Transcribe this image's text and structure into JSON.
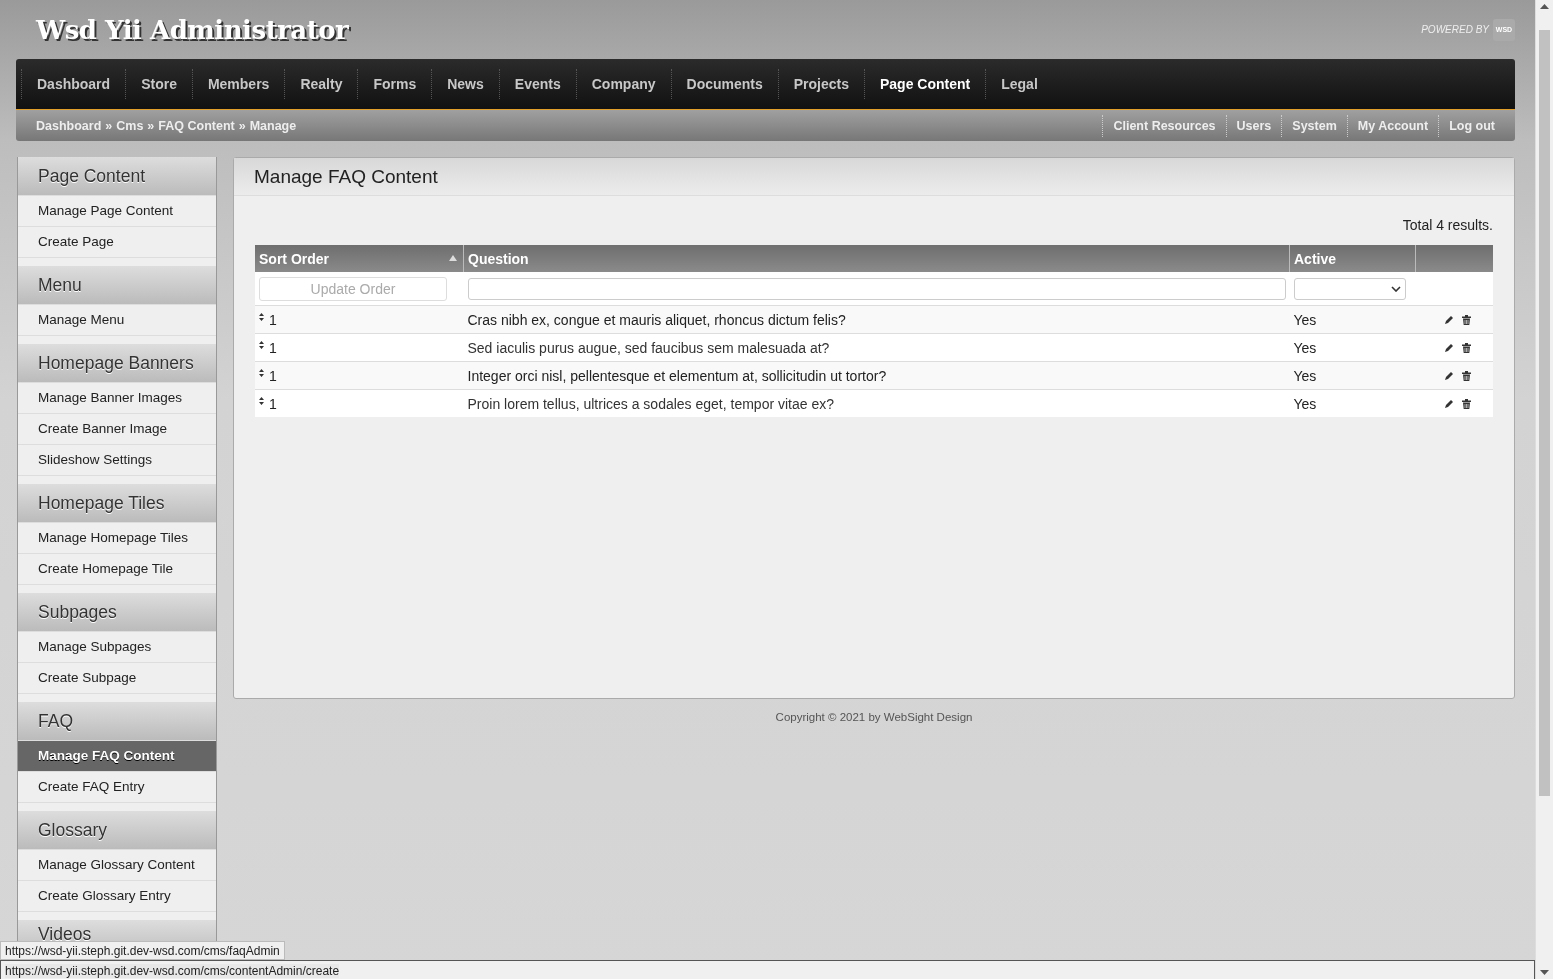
{
  "header": {
    "title": "Wsd Yii Administrator",
    "powered_by": "POWERED BY",
    "logo": "WSD"
  },
  "nav": [
    {
      "label": "Dashboard",
      "selected": false
    },
    {
      "label": "Store",
      "selected": false
    },
    {
      "label": "Members",
      "selected": false
    },
    {
      "label": "Realty",
      "selected": false
    },
    {
      "label": "Forms",
      "selected": false
    },
    {
      "label": "News",
      "selected": false
    },
    {
      "label": "Events",
      "selected": false
    },
    {
      "label": "Company",
      "selected": false
    },
    {
      "label": "Documents",
      "selected": false
    },
    {
      "label": "Projects",
      "selected": false
    },
    {
      "label": "Page Content",
      "selected": true
    },
    {
      "label": "Legal",
      "selected": false
    }
  ],
  "breadcrumb": {
    "separator": "»",
    "items": [
      "Dashboard",
      "Cms",
      "FAQ Content",
      "Manage"
    ]
  },
  "user_menu": [
    "Client Resources",
    "Users",
    "System",
    "My Account",
    "Log out"
  ],
  "sidebar": [
    {
      "title": "Page Content",
      "items": [
        {
          "label": "Manage Page Content",
          "selected": false
        },
        {
          "label": "Create Page",
          "selected": false
        }
      ]
    },
    {
      "title": "Menu",
      "items": [
        {
          "label": "Manage Menu",
          "selected": false
        }
      ]
    },
    {
      "title": "Homepage Banners",
      "items": [
        {
          "label": "Manage Banner Images",
          "selected": false
        },
        {
          "label": "Create Banner Image",
          "selected": false
        },
        {
          "label": "Slideshow Settings",
          "selected": false
        }
      ]
    },
    {
      "title": "Homepage Tiles",
      "items": [
        {
          "label": "Manage Homepage Tiles",
          "selected": false
        },
        {
          "label": "Create Homepage Tile",
          "selected": false
        }
      ]
    },
    {
      "title": "Subpages",
      "items": [
        {
          "label": "Manage Subpages",
          "selected": false
        },
        {
          "label": "Create Subpage",
          "selected": false
        }
      ]
    },
    {
      "title": "FAQ",
      "items": [
        {
          "label": "Manage FAQ Content",
          "selected": true
        },
        {
          "label": "Create FAQ Entry",
          "selected": false
        }
      ]
    },
    {
      "title": "Glossary",
      "items": [
        {
          "label": "Manage Glossary Content",
          "selected": false
        },
        {
          "label": "Create Glossary Entry",
          "selected": false
        }
      ]
    },
    {
      "title": "Videos"
    }
  ],
  "main": {
    "title": "Manage FAQ Content",
    "summary": "Total 4 results.",
    "table": {
      "columns": [
        {
          "label": "Sort Order",
          "sorted": true
        },
        {
          "label": "Question",
          "sorted": false
        },
        {
          "label": "Active",
          "sorted": false
        }
      ],
      "filters": {
        "update_button": "Update Order"
      },
      "rows": [
        {
          "order": "1",
          "question": "Cras nibh ex, congue et mauris aliquet, rhoncus dictum felis?",
          "active": "Yes"
        },
        {
          "order": "1",
          "question": "Sed iaculis purus augue, sed faucibus sem malesuada at?",
          "active": "Yes"
        },
        {
          "order": "1",
          "question": "Integer orci nisl, pellentesque et elementum at, sollicitudin ut tortor?",
          "active": "Yes"
        },
        {
          "order": "1",
          "question": "Proin lorem tellus, ultrices a sodales eget, tempor vitae ex?",
          "active": "Yes"
        }
      ]
    }
  },
  "footer": {
    "copyright": "Copyright © 2021 by WebSight Design"
  },
  "status_bar": {
    "link_preview": "https://wsd-yii.steph.git.dev-wsd.com/cms/faqAdmin",
    "status": "https://wsd-yii.steph.git.dev-wsd.com/cms/contentAdmin/create"
  }
}
